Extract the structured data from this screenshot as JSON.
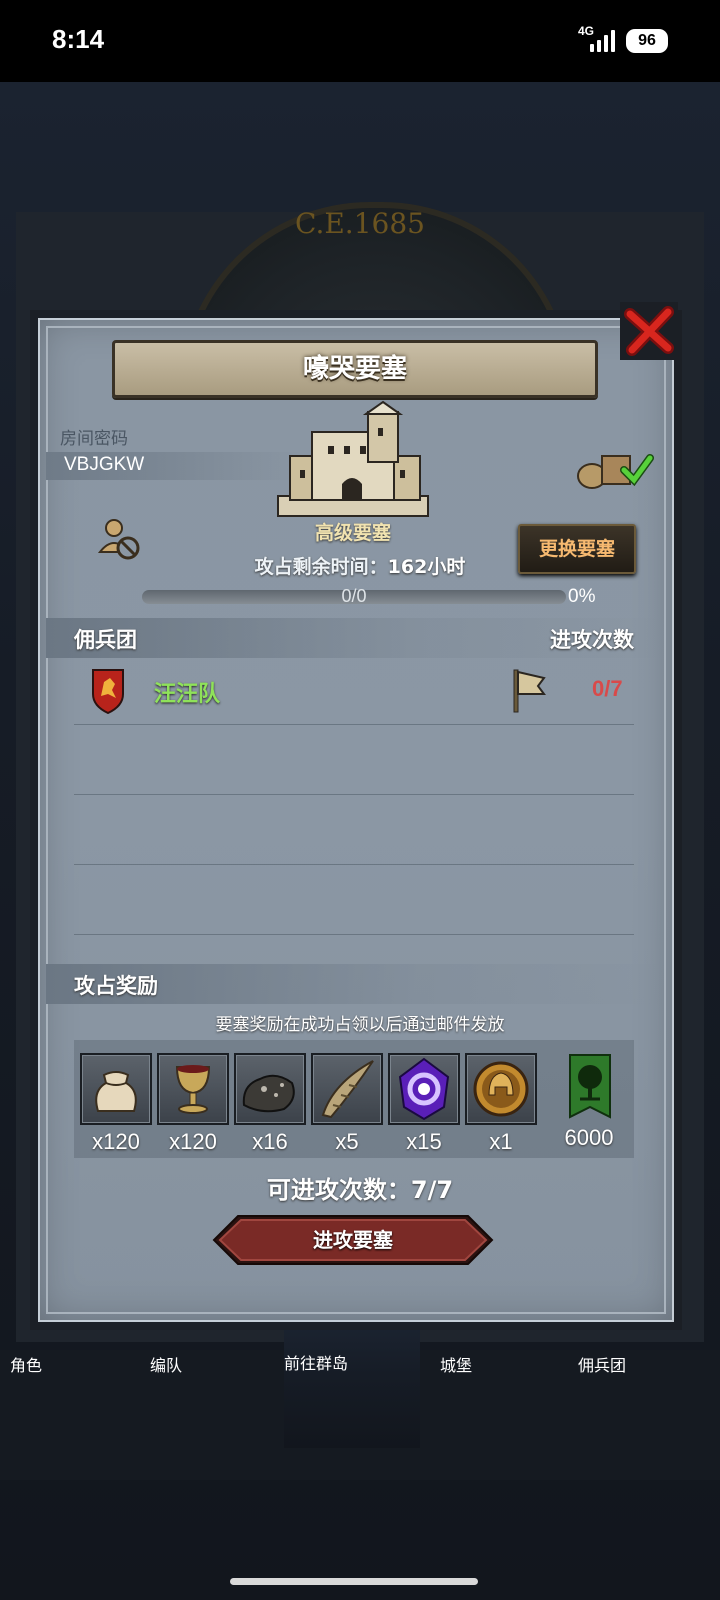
{
  "status_bar": {
    "time": "8:14",
    "network": "4G",
    "battery": "96"
  },
  "background": {
    "year": "C.E.1685",
    "nav": [
      {
        "label": "角色"
      },
      {
        "label": "编队"
      },
      {
        "label": "前往群岛",
        "active": true
      },
      {
        "label": "城堡"
      },
      {
        "label": "佣兵团"
      }
    ]
  },
  "dialog": {
    "title": "嚎哭要塞",
    "room": {
      "label": "房间密码",
      "code": "VBJGKW"
    },
    "fortress_label": "高级要塞",
    "change_button": "更换要塞",
    "timer": {
      "label": "攻占剩余时间：",
      "value": "162小时"
    },
    "progress": {
      "text": "0/0",
      "percent_label": "0%",
      "fraction": 0
    },
    "mercenary_section": {
      "left": "佣兵团",
      "right": "进攻次数"
    },
    "mercenaries": [
      {
        "name": "汪汪队",
        "attempts": "0/7"
      }
    ],
    "rewards_section": {
      "title": "攻占奖励",
      "note": "要塞奖励在成功占领以后通过邮件发放"
    },
    "rewards": [
      {
        "icon": "sack-icon",
        "qty": "x120"
      },
      {
        "icon": "goblet-icon",
        "qty": "x120"
      },
      {
        "icon": "ore-icon",
        "qty": "x16"
      },
      {
        "icon": "horn-icon",
        "qty": "x5"
      },
      {
        "icon": "purple-crystal-icon",
        "qty": "x15"
      },
      {
        "icon": "helmet-medal-icon",
        "qty": "x1"
      },
      {
        "icon": "tree-banner-icon",
        "qty": "6000"
      }
    ],
    "attempts": {
      "label": "可进攻次数：",
      "value": "7/7"
    },
    "attack_button": "进攻要塞"
  },
  "colors": {
    "accent_green": "#8fe25a",
    "accent_red": "#d84a4a",
    "button_orange": "#f6b970"
  }
}
